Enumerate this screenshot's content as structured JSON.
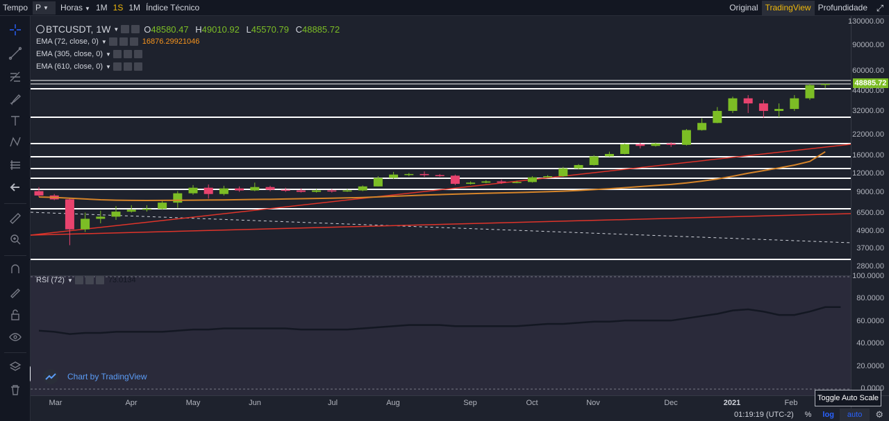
{
  "toolbar": {
    "tempo_label": "Tempo",
    "symbol_select": "P",
    "interval_select": "Horas",
    "interval_1m_label": "1M",
    "interval_1s_label": "1S",
    "interval_1mo_label": "1M",
    "indicators_label": "Índice Técnico",
    "view_original": "Original",
    "view_tradingview": "TradingView",
    "view_depth": "Profundidade",
    "expand_icon": "expand-icon"
  },
  "legend": {
    "symbol": "BTCUSDT, 1W",
    "open_key": "O",
    "open": "48580.47",
    "high_key": "H",
    "high": "49010.92",
    "low_key": "L",
    "low": "45570.79",
    "close_key": "C",
    "close": "48885.72",
    "ema1": "EMA (72, close, 0)",
    "ema1_value": "16876.29921046",
    "ema2": "EMA (305, close, 0)",
    "ema3": "EMA (610, close, 0)",
    "rsi": "RSI (72)",
    "rsi_value": "73.0134"
  },
  "price_axis": {
    "labels": [
      "130000.00",
      "90000.00",
      "60000.00",
      "44000.00",
      "32000.00",
      "22000.00",
      "16000.00",
      "12000.00",
      "9000.00",
      "6500.00",
      "4900.00",
      "3700.00",
      "2800.00"
    ],
    "last_price": "48885.72",
    "last_price_color": "#7cbd25"
  },
  "rsi_axis": {
    "labels": [
      "100.0000",
      "80.0000",
      "60.0000",
      "40.0000",
      "20.0000",
      "0.0000"
    ]
  },
  "time_axis": {
    "labels": [
      "Mar",
      "Apr",
      "May",
      "Jun",
      "Jul",
      "Aug",
      "Sep",
      "Oct",
      "Nov",
      "Dec",
      "2021",
      "Feb"
    ]
  },
  "bottom": {
    "clock": "01:19:19 (UTC-2)",
    "percent": "%",
    "log": "log",
    "auto": "auto",
    "settings_icon": "gear-icon",
    "tooltip": "Toggle Auto Scale"
  },
  "watermark": "Chart by TradingView",
  "colors": {
    "up": "#7cbd25",
    "down": "#e8436e",
    "ema72": "#d6852a",
    "trend": "#e0342a",
    "rsi": "#131722",
    "active": "#f0b90b",
    "accent": "#2962ff"
  },
  "chart_data": {
    "type": "candlestick",
    "symbol": "BTCUSDT",
    "interval": "1W",
    "y_scale": "log",
    "ylim": [
      2800,
      130000
    ],
    "x": [
      "Mar",
      "Apr",
      "May",
      "Jun",
      "Jul",
      "Aug",
      "Sep",
      "Oct",
      "Nov",
      "Dec",
      "2021",
      "Feb"
    ],
    "candles": [
      [
        9100,
        8500,
        9700,
        8300
      ],
      [
        8500,
        8000,
        8700,
        7900
      ],
      [
        8000,
        5000,
        8200,
        3900
      ],
      [
        5000,
        5900,
        6500,
        4800
      ],
      [
        5900,
        6100,
        6700,
        5500
      ],
      [
        6100,
        6600,
        7200,
        5800
      ],
      [
        6600,
        6800,
        7300,
        6500
      ],
      [
        6800,
        6900,
        7300,
        6600
      ],
      [
        6900,
        7600,
        7800,
        6800
      ],
      [
        7600,
        8800,
        9100,
        7000
      ],
      [
        8800,
        9600,
        10000,
        8600
      ],
      [
        9600,
        8700,
        10100,
        8100
      ],
      [
        8700,
        9500,
        9900,
        8500
      ],
      [
        9500,
        9200,
        9800,
        9000
      ],
      [
        9200,
        9700,
        10400,
        9100
      ],
      [
        9700,
        9300,
        9900,
        9100
      ],
      [
        9300,
        9200,
        9600,
        9000
      ],
      [
        9200,
        9000,
        9500,
        8900
      ],
      [
        9000,
        9200,
        9400,
        8900
      ],
      [
        9200,
        9100,
        9400,
        8900
      ],
      [
        9100,
        9200,
        9400,
        9000
      ],
      [
        9200,
        9800,
        9950,
        9100
      ],
      [
        9800,
        11200,
        11500,
        9800
      ],
      [
        11200,
        11800,
        12300,
        11000
      ],
      [
        11800,
        11900,
        12100,
        11500
      ],
      [
        11900,
        11700,
        12400,
        11400
      ],
      [
        11700,
        11600,
        11900,
        11400
      ],
      [
        11600,
        10200,
        11800,
        10000
      ],
      [
        10200,
        10400,
        10600,
        10100
      ],
      [
        10400,
        10600,
        10800,
        10300
      ],
      [
        10600,
        10400,
        10900,
        10200
      ],
      [
        10400,
        10500,
        10700,
        10300
      ],
      [
        10500,
        11300,
        11500,
        10400
      ],
      [
        11300,
        11500,
        11700,
        11200
      ],
      [
        11500,
        13000,
        13300,
        11400
      ],
      [
        13000,
        13700,
        13900,
        12800
      ],
      [
        13700,
        15700,
        16000,
        13600
      ],
      [
        15700,
        16300,
        16900,
        15600
      ],
      [
        16300,
        19000,
        19200,
        16200
      ],
      [
        19000,
        18500,
        19400,
        17800
      ],
      [
        18500,
        19200,
        19500,
        18300
      ],
      [
        19200,
        18800,
        19600,
        18200
      ],
      [
        18800,
        23700,
        24100,
        18600
      ],
      [
        23700,
        26500,
        28500,
        23500
      ],
      [
        26500,
        32000,
        34000,
        26400
      ],
      [
        32000,
        39000,
        40000,
        31000
      ],
      [
        39000,
        36000,
        41000,
        31000
      ],
      [
        36000,
        32000,
        38000,
        28800
      ],
      [
        32000,
        33000,
        36000,
        29000
      ],
      [
        33000,
        39000,
        41000,
        32000
      ],
      [
        39000,
        48000,
        49000,
        38000
      ],
      [
        48580,
        48885,
        49010,
        45570
      ]
    ],
    "ema72": [
      8300,
      8250,
      8150,
      8050,
      7950,
      7900,
      7880,
      7870,
      7880,
      7890,
      7900,
      7920,
      7930,
      7960,
      7990,
      8010,
      8050,
      8080,
      8110,
      8150,
      8190,
      8240,
      8320,
      8400,
      8480,
      8560,
      8620,
      8690,
      8750,
      8800,
      8850,
      8900,
      8960,
      9020,
      9100,
      9200,
      9320,
      9450,
      9600,
      9770,
      9950,
      10120,
      10350,
      10650,
      11000,
      11500,
      12050,
      12550,
      13100,
      13700,
      14500,
      16876
    ],
    "trendline_from": [
      4500,
      6900
    ],
    "trendline_to": [
      1220,
      18800
    ],
    "trendline2_from": [
      4500,
      6900
    ],
    "trendline2_to": [
      1220,
      18800
    ],
    "rsi_series": [
      52,
      51,
      49,
      50,
      50,
      51,
      51,
      51,
      51,
      52,
      53,
      53,
      54,
      54,
      54,
      54,
      54,
      53,
      53,
      53,
      53,
      54,
      55,
      56,
      57,
      57,
      57,
      56,
      56,
      56,
      56,
      56,
      57,
      58,
      58,
      59,
      60,
      60,
      61,
      61,
      61,
      61,
      63,
      65,
      67,
      70,
      71,
      69,
      66,
      66,
      69,
      73,
      73
    ]
  }
}
